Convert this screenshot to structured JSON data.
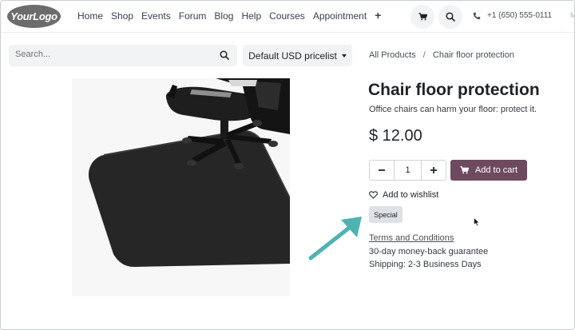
{
  "header": {
    "logo_text": "YourLogo",
    "nav": [
      "Home",
      "Shop",
      "Events",
      "Forum",
      "Blog",
      "Help",
      "Courses",
      "Appointment"
    ],
    "add_menu_icon": "plus-icon",
    "cart_icon": "cart-icon",
    "search_icon": "search-icon",
    "phone": "+1 (650) 555-0111",
    "edge_text": "M"
  },
  "search": {
    "placeholder": "Search...",
    "value": ""
  },
  "pricelist": {
    "label": "Default USD pricelist"
  },
  "breadcrumb": {
    "parent": "All Products",
    "separator": "/",
    "current": "Chair floor protection"
  },
  "product": {
    "title": "Chair floor protection",
    "subtitle": "Office chairs can harm your floor: protect it.",
    "price": "$ 12.00",
    "quantity": "1",
    "add_to_cart": "Add to cart",
    "wishlist": "Add to wishlist",
    "badge": "Special",
    "terms": "Terms and Conditions",
    "guarantee": "30-day money-back guarantee",
    "shipping": "Shipping: 2-3 Business Days"
  },
  "colors": {
    "accent": "#6e4a5f",
    "annotation_arrow": "#4fb3b0",
    "logo_bg": "#6c6c6c"
  }
}
